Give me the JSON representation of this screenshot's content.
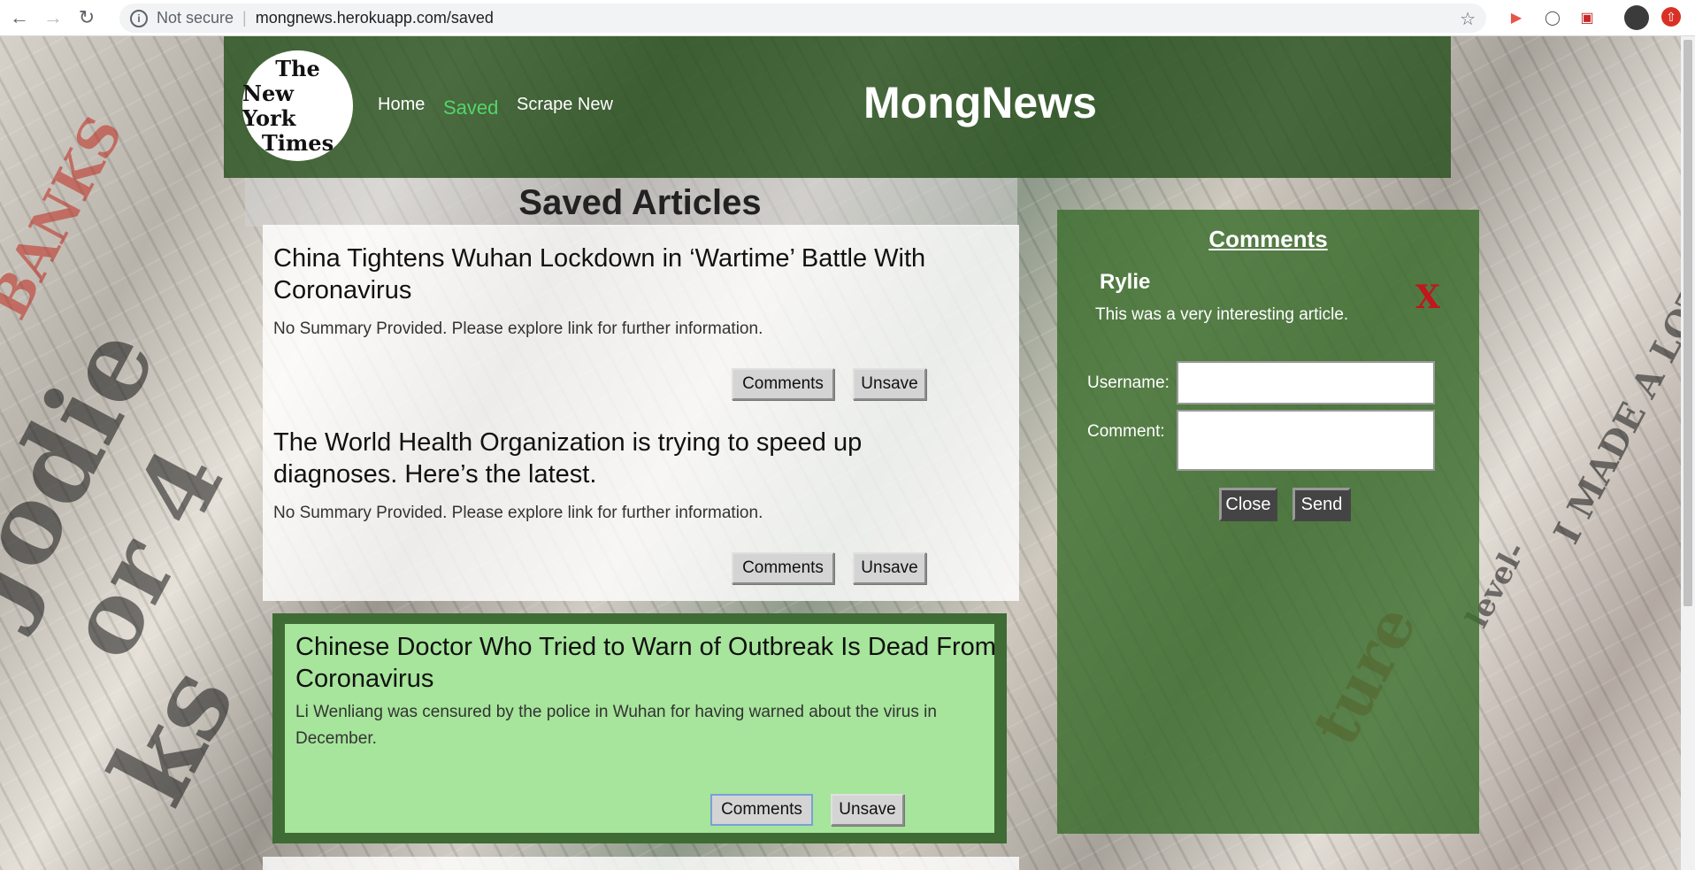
{
  "browser": {
    "security_label": "Not secure",
    "url": "mongnews.herokuapp.com/saved"
  },
  "header": {
    "logo_lines": [
      "The",
      "New York",
      "Times"
    ],
    "nav": [
      "Home",
      "Saved",
      "Scrape New"
    ],
    "brand": "MongNews"
  },
  "saved_section_title": "Saved Articles",
  "articles": [
    {
      "title": "China Tightens Wuhan Lockdown in ‘Wartime’ Battle With Coronavirus",
      "summary": "No Summary Provided. Please explore link for further information.",
      "comments_label": "Comments",
      "unsave_label": "Unsave"
    },
    {
      "title": "The World Health Organization is trying to speed up diagnoses. Here’s the latest.",
      "summary": "No Summary Provided. Please explore link for further information.",
      "comments_label": "Comments",
      "unsave_label": "Unsave"
    },
    {
      "title": "Chinese Doctor Who Tried to Warn of Outbreak Is Dead From Coronavirus",
      "summary": "Li Wenliang was censured by the police in Wuhan for having warned about the virus in December.",
      "comments_label": "Comments",
      "unsave_label": "Unsave"
    }
  ],
  "comments_panel": {
    "title": "Comments",
    "comment": {
      "user": "Rylie",
      "text": "This was a very interesting article.",
      "delete_label": "X"
    },
    "form": {
      "username_label": "Username:",
      "username_value": "",
      "comment_label": "Comment:",
      "comment_value": "",
      "close_label": "Close",
      "send_label": "Send"
    }
  },
  "colors": {
    "header_green": "#28501e",
    "active_nav": "#53d66a",
    "highlight_card": "#a6e59b",
    "delete_red": "#c0171c"
  }
}
